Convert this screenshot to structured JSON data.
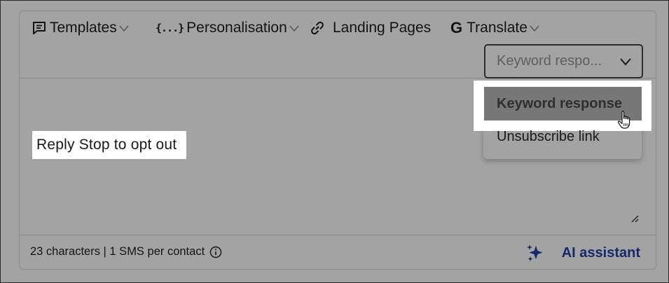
{
  "toolbar": {
    "templates_label": "Templates",
    "personalisation_label": "Personalisation",
    "personalisation_icon": "{...}",
    "landing_pages_label": "Landing Pages",
    "translate_label": "Translate",
    "translate_icon": "G"
  },
  "insert_select": {
    "value": "Keyword respo...",
    "options": [
      "Keyword response",
      "Unsubscribe link"
    ],
    "highlighted": "Keyword response"
  },
  "message": {
    "text": "Reply Stop to opt out"
  },
  "footer": {
    "counter_text": "23 characters | 1 SMS per contact",
    "ai_assistant_label": "AI assistant"
  },
  "colors": {
    "overlay_bg": "#a3a3a3",
    "ai_accent": "#142a6b",
    "highlight_item": "#777777"
  },
  "icons": [
    "message-square-icon",
    "chevron-down-icon",
    "braces-icon",
    "link-icon",
    "google-translate-icon",
    "info-icon",
    "sparkle-icon",
    "resize-handle-icon",
    "hand-pointer-icon"
  ]
}
